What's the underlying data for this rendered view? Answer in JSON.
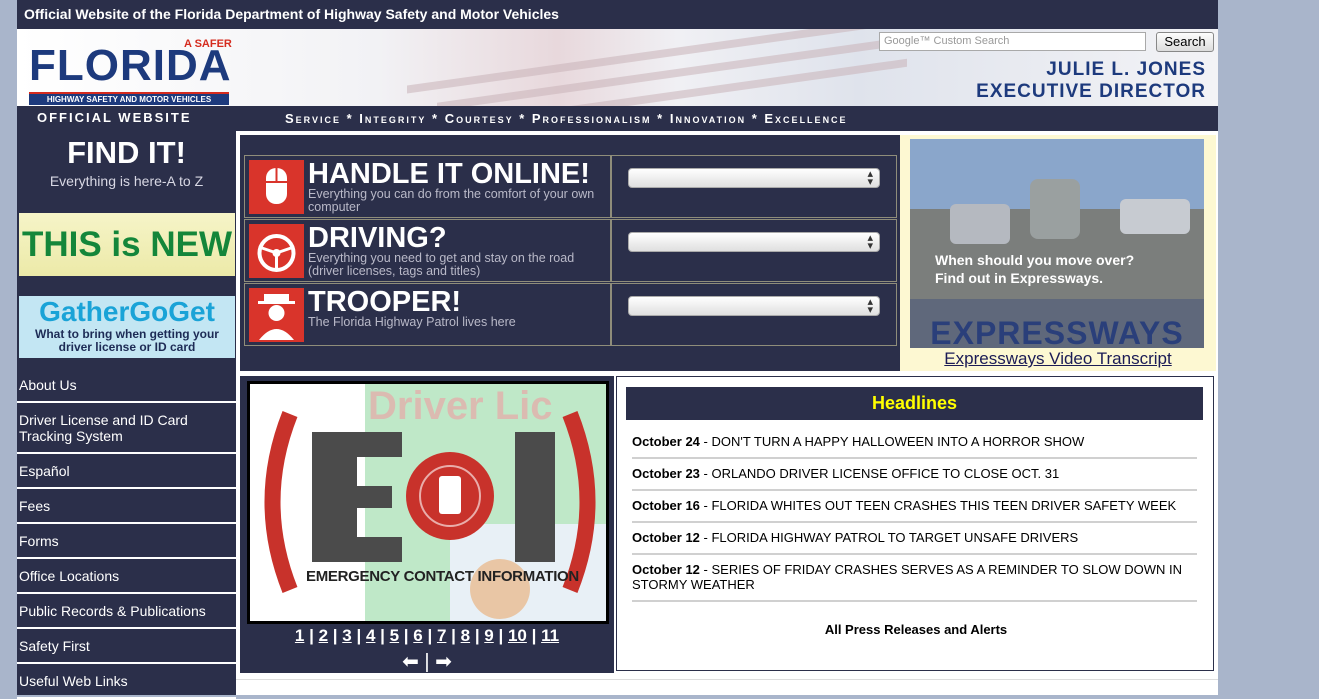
{
  "top_bar": {
    "title": "Official Website of the Florida Department of Highway Safety and Motor Vehicles"
  },
  "header": {
    "logo": {
      "safer": "A SAFER",
      "florida": "FLORIDA",
      "subtitle": "HIGHWAY SAFETY AND MOTOR VEHICLES"
    },
    "search": {
      "placeholder_brand": "Google",
      "placeholder": "Custom Search",
      "button": "Search"
    },
    "director_name": "JULIE L. JONES",
    "director_title": "EXECUTIVE DIRECTOR",
    "official_label": "OFFICIAL WEBSITE",
    "motto": "Service * Integrity * Courtesy * Professionalism * Innovation * Excellence"
  },
  "sidebar": {
    "findit_title": "FIND IT!",
    "findit_sub": "Everything is here-A to Z",
    "new_banner": "THIS is NEW",
    "gather_title": "GatherGoGet",
    "gather_sub": "What to bring when getting your driver license or ID card",
    "nav": [
      {
        "label": "About Us"
      },
      {
        "label": "Driver License and ID Card Tracking System"
      },
      {
        "label": "Español"
      },
      {
        "label": "Fees"
      },
      {
        "label": "Forms"
      },
      {
        "label": "Office Locations"
      },
      {
        "label": "Public Records & Publications"
      },
      {
        "label": "Safety First"
      },
      {
        "label": "Useful Web Links"
      }
    ]
  },
  "handle": {
    "rows": [
      {
        "title": "HANDLE IT ONLINE!",
        "sub": "Everything you can do from the comfort of your own computer",
        "icon": "mouse-icon"
      },
      {
        "title": "DRIVING?",
        "sub": "Everything you need to get and stay on the road (driver licenses, tags and titles)",
        "icon": "steering-wheel-icon"
      },
      {
        "title": "TROOPER!",
        "sub": "The Florida Highway Patrol lives here",
        "icon": "trooper-icon"
      }
    ]
  },
  "video": {
    "caption_1": "When should you move over?",
    "caption_2": "Find out in Expressways.",
    "overlay": "EXPRESSWAYS",
    "link": "Expressways Video Transcript"
  },
  "slideshow": {
    "eci_text": "EMERGENCY CONTACT INFORMATION",
    "eci_letters": "ECI",
    "overlay_text": "Driver Lic",
    "pages": [
      "1",
      "2",
      "3",
      "4",
      "5",
      "6",
      "7",
      "8",
      "9",
      "10",
      "11"
    ]
  },
  "headlines": {
    "title": "Headlines",
    "items": [
      {
        "date": "October 24",
        "text": " - DON'T TURN A HAPPY HALLOWEEN INTO A HORROR SHOW"
      },
      {
        "date": "October 23",
        "text": " - ORLANDO DRIVER LICENSE OFFICE TO CLOSE OCT. 31"
      },
      {
        "date": "October 16",
        "text": " - FLORIDA WHITES OUT TEEN CRASHES THIS TEEN DRIVER SAFETY WEEK"
      },
      {
        "date": "October 12",
        "text": " - FLORIDA HIGHWAY PATROL TO TARGET UNSAFE DRIVERS"
      },
      {
        "date": "October 12",
        "text": " - SERIES OF FRIDAY CRASHES SERVES AS A REMINDER TO SLOW DOWN IN STORMY WEATHER"
      }
    ],
    "all_link": "All Press Releases and Alerts"
  },
  "colors": {
    "navy": "#2b2f4a",
    "headline_yellow": "#ffff00",
    "brand_red": "#d9342b",
    "brand_blue": "#1d3a7d"
  }
}
